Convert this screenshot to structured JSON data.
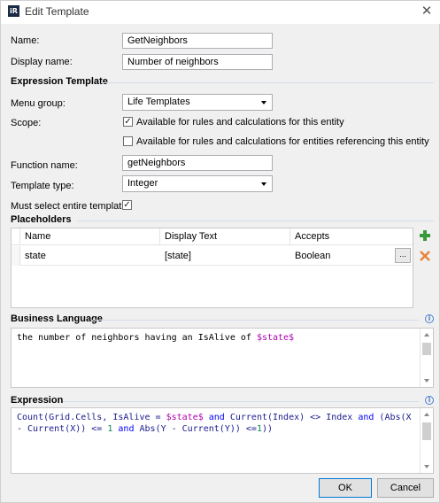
{
  "window": {
    "title": "Edit Template",
    "app_icon": "iR",
    "close_glyph": "✕"
  },
  "fields": {
    "name_label": "Name:",
    "name_value": "GetNeighbors",
    "display_name_label": "Display name:",
    "display_name_value": "Number of neighbors"
  },
  "expression_template": {
    "heading": "Expression Template",
    "menu_group_label": "Menu group:",
    "menu_group_value": "Life Templates",
    "scope_label": "Scope:",
    "scope_option_1": "Available for rules and calculations for this entity",
    "scope_option_1_checked": true,
    "scope_option_2": "Available for rules and calculations for entities referencing this entity",
    "scope_option_2_checked": false,
    "function_name_label": "Function name:",
    "function_name_value": "getNeighbors",
    "template_type_label": "Template type:",
    "template_type_value": "Integer",
    "must_select_label": "Must select entire template:",
    "must_select_checked": true
  },
  "placeholders": {
    "heading": "Placeholders",
    "columns": [
      "Name",
      "Display Text",
      "Accepts"
    ],
    "rows": [
      {
        "name": "state",
        "display_text": "[state]",
        "accepts": "Boolean"
      }
    ],
    "ellipsis_label": "...",
    "add_icon": "plus-icon",
    "delete_icon": "delete-x-icon"
  },
  "business_language": {
    "heading": "Business Language",
    "text_plain": "the number of neighbors having an IsAlive of ",
    "text_var": "$state$"
  },
  "expression": {
    "heading": "Expression",
    "tokens": [
      {
        "t": "Count(Grid.Cells, IsAlive = ",
        "c": "#1a1a8c"
      },
      {
        "t": "$state$",
        "c": "#b000b0"
      },
      {
        "t": " and ",
        "c": "#0000ff"
      },
      {
        "t": "Current(Index) <> Index ",
        "c": "#1a1a8c"
      },
      {
        "t": "and",
        "c": "#0000ff"
      },
      {
        "t": " (Abs(X - Current(X)) <= ",
        "c": "#1a1a8c"
      },
      {
        "t": "1",
        "c": "#098658"
      },
      {
        "t": " and ",
        "c": "#0000ff"
      },
      {
        "t": "Abs(Y - Current(Y)) <=",
        "c": "#1a1a8c"
      },
      {
        "t": "1",
        "c": "#098658"
      },
      {
        "t": "))",
        "c": "#1a1a8c"
      }
    ]
  },
  "buttons": {
    "ok": "OK",
    "cancel": "Cancel"
  },
  "colors": {
    "accent": "#0078d7",
    "section_line": "#d4dde8",
    "add_green": "#3a9a3a",
    "delete_orange": "#e8833a",
    "variable_magenta": "#b000b0"
  }
}
